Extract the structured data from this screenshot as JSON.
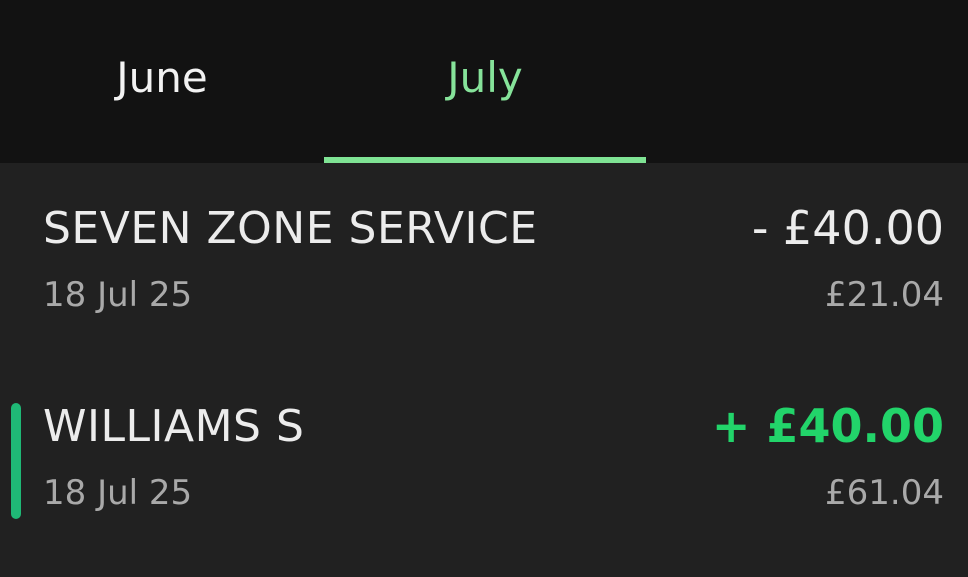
{
  "tabs": [
    {
      "label": "June",
      "selected": false
    },
    {
      "label": "July",
      "selected": true
    }
  ],
  "colors": {
    "active_tab": "#86e39a",
    "credit_amount": "#22d46a",
    "credit_marker": "#1fb876",
    "background": "#212121",
    "tab_bar": "#121212"
  },
  "transactions": [
    {
      "merchant": "SEVEN ZONE SERVICE",
      "date": "18 Jul 25",
      "amount": "- £40.00",
      "balance": "£21.04",
      "type": "debit"
    },
    {
      "merchant": "WILLIAMS S",
      "date": "18 Jul 25",
      "amount": "+ £40.00",
      "balance": "£61.04",
      "type": "credit"
    }
  ]
}
